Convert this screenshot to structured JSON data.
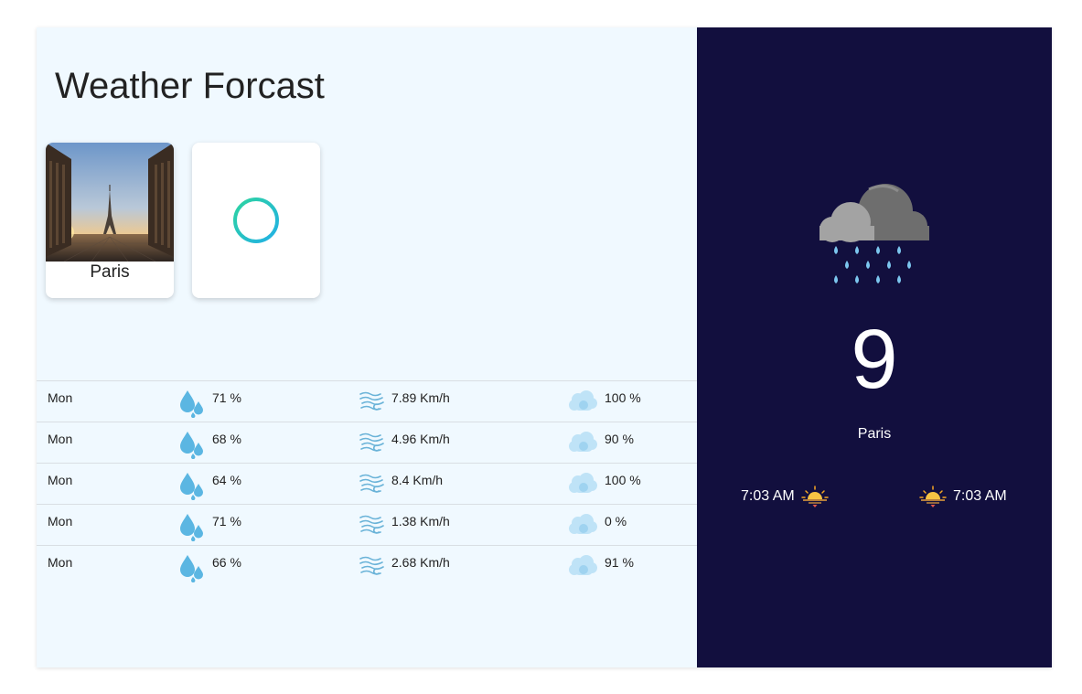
{
  "app": {
    "title": "Weather Forcast"
  },
  "cities": [
    {
      "name": "Paris"
    }
  ],
  "add_card": {
    "icon": "plus-circle-icon"
  },
  "forecast": [
    {
      "day": "Mon",
      "humidity": "71 %",
      "wind": "7.89 Km/h",
      "clouds": "100 %"
    },
    {
      "day": "Mon",
      "humidity": "68 %",
      "wind": "4.96 Km/h",
      "clouds": "90 %"
    },
    {
      "day": "Mon",
      "humidity": "64 %",
      "wind": "8.4 Km/h",
      "clouds": "100 %"
    },
    {
      "day": "Mon",
      "humidity": "71 %",
      "wind": "1.38 Km/h",
      "clouds": "0 %"
    },
    {
      "day": "Mon",
      "humidity": "66 %",
      "wind": "2.68 Km/h",
      "clouds": "91 %"
    }
  ],
  "current": {
    "icon": "rain-cloud-icon",
    "temperature": "9",
    "city": "Paris",
    "sunrise": "7:03 AM",
    "sunset": "7:03 AM"
  },
  "colors": {
    "left_bg": "#f0f9ff",
    "right_bg": "#120f3e",
    "accent_gradient_start": "#2dd4a0",
    "accent_gradient_end": "#22b8e0"
  }
}
